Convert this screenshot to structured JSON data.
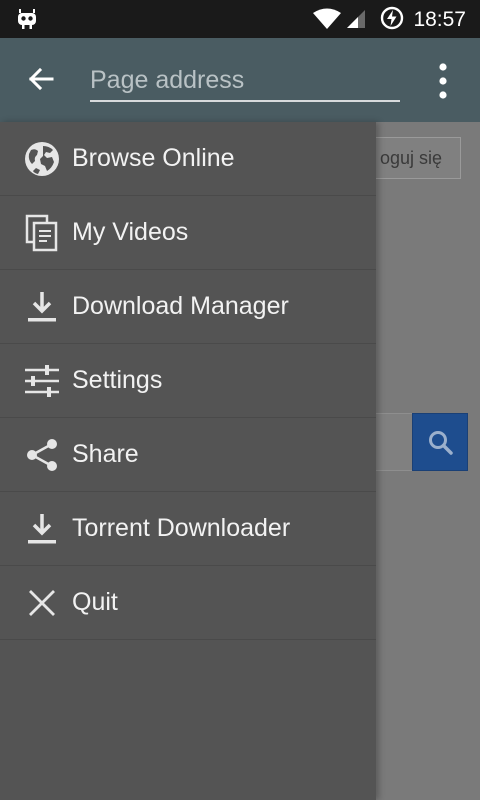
{
  "status_bar": {
    "time": "18:57",
    "icons": [
      "android-app-icon",
      "wifi-icon",
      "signal-icon",
      "battery-charging-icon"
    ]
  },
  "toolbar": {
    "address_placeholder": "Page address",
    "icons": [
      "back-arrow-icon",
      "overflow-menu-icon"
    ]
  },
  "background_page": {
    "login_label": "oguj się",
    "search_button_color": "#1e4d8e"
  },
  "drawer": {
    "items": [
      {
        "label": "Browse Online",
        "icon": "globe-icon"
      },
      {
        "label": "My Videos",
        "icon": "documents-icon"
      },
      {
        "label": "Download Manager",
        "icon": "download-icon"
      },
      {
        "label": "Settings",
        "icon": "sliders-icon"
      },
      {
        "label": "Share",
        "icon": "share-icon"
      },
      {
        "label": "Torrent Downloader",
        "icon": "download-icon"
      },
      {
        "label": "Quit",
        "icon": "close-icon"
      }
    ]
  },
  "colors": {
    "toolbar": "#4a5c62",
    "drawer": "#545454",
    "statusbar": "#1a1a1a"
  }
}
